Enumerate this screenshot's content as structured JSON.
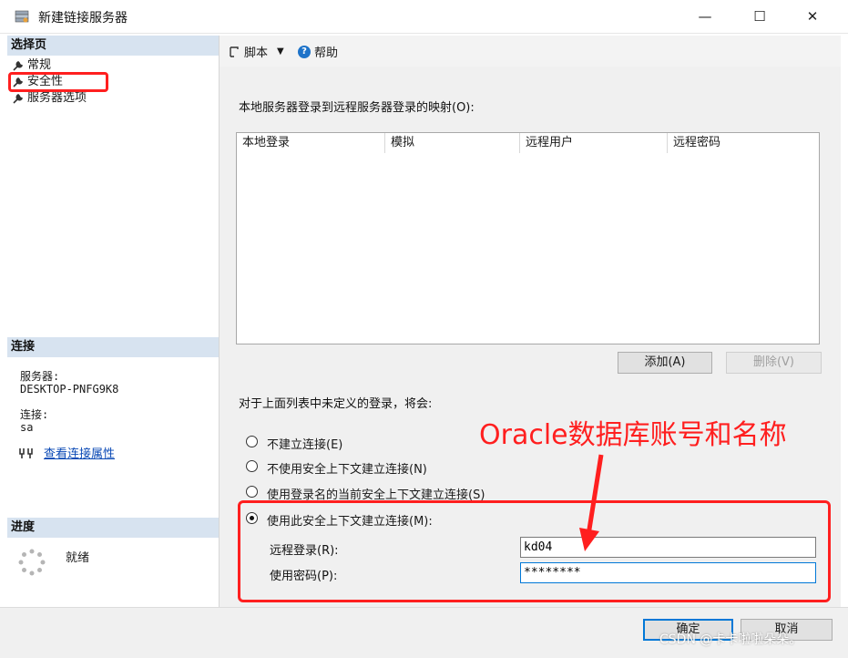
{
  "window": {
    "title": "新建链接服务器",
    "minimize": "—",
    "maximize": "☐",
    "close": "✕"
  },
  "left_panel": {
    "select_page_header": "选择页",
    "pages": [
      {
        "label": "常规"
      },
      {
        "label": "安全性"
      },
      {
        "label": "服务器选项"
      }
    ],
    "connection_header": "连接",
    "server_label": "服务器:",
    "server_value": "DESKTOP-PNFG9K8",
    "connection_label": "连接:",
    "connection_value": "sa",
    "view_connection_props": "查看连接属性",
    "progress_header": "进度",
    "progress_status": "就绪"
  },
  "toolbar": {
    "script_label": "脚本",
    "help_label": "帮助"
  },
  "mapping": {
    "label": "本地服务器登录到远程服务器登录的映射(O):",
    "columns": [
      "本地登录",
      "模拟",
      "远程用户",
      "远程密码"
    ],
    "rows": [],
    "add_button": "添加(A)",
    "remove_button": "删除(V)"
  },
  "undefined_logins": {
    "label": "对于上面列表中未定义的登录，将会:",
    "options": [
      {
        "label": "不建立连接(E)",
        "checked": false
      },
      {
        "label": "不使用安全上下文建立连接(N)",
        "checked": false
      },
      {
        "label": "使用登录名的当前安全上下文建立连接(S)",
        "checked": false
      },
      {
        "label": "使用此安全上下文建立连接(M):",
        "checked": true
      }
    ],
    "remote_login_label": "远程登录(R):",
    "remote_login_value": "kd04",
    "password_label": "使用密码(P):",
    "password_value": "********"
  },
  "annotation": {
    "text": "Oracle数据库账号和名称",
    "color": "#ff1f1f"
  },
  "footer": {
    "ok_button": "确定",
    "cancel_button": "取消",
    "watermark": "CSDN @卡卡啦啦朵朵。"
  },
  "colors": {
    "header_bg": "#d7e3f0",
    "panel_bg": "#f0f0f0",
    "link": "#0a49b5",
    "focus_border": "#0078d7"
  }
}
